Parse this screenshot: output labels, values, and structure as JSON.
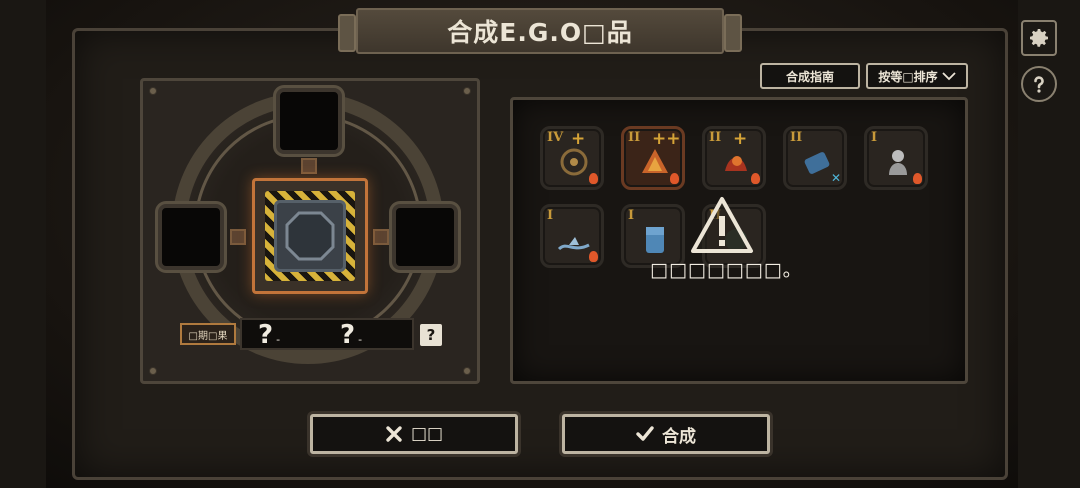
{
  "header": {
    "title": "合成E.G.O□品"
  },
  "machine": {
    "result_label": "□期□果",
    "result_values": [
      {
        "value": "?",
        "unit": "-"
      },
      {
        "value": "?",
        "unit": "-"
      }
    ],
    "result_help": "?"
  },
  "toolbar": {
    "guide_label": "合成指南",
    "sort_label": "按等□排序"
  },
  "inventory": {
    "items": [
      {
        "tier": "IV",
        "plus": "+",
        "badge": "fire"
      },
      {
        "tier": "II",
        "plus": "++",
        "badge": "fire"
      },
      {
        "tier": "II",
        "plus": "+",
        "badge": "fire"
      },
      {
        "tier": "II",
        "plus": "",
        "badge": "x"
      },
      {
        "tier": "I",
        "plus": "",
        "badge": "fire"
      },
      {
        "tier": "I",
        "plus": "",
        "badge": "fire"
      },
      {
        "tier": "I",
        "plus": "",
        "badge": ""
      },
      {
        "tier": "II",
        "plus": "",
        "badge": ""
      }
    ],
    "notice_text": "□□□□□□□。"
  },
  "actions": {
    "cancel_label": "□□",
    "synth_label": "合成"
  },
  "colors": {
    "accent_orange": "#c2743a",
    "hazard_yellow": "#d7b33a",
    "tier_gold": "#c89a3a"
  }
}
